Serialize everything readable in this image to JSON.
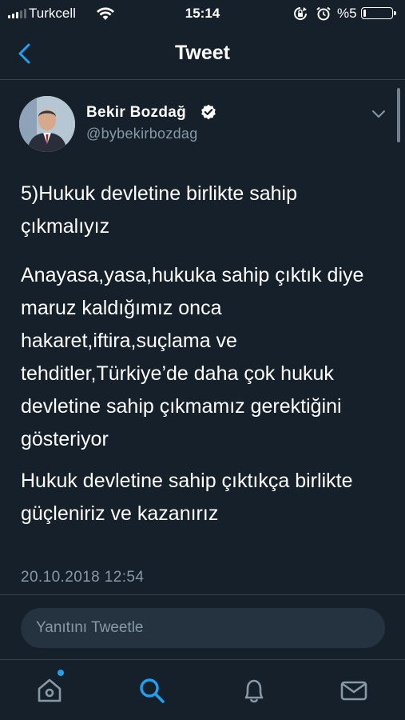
{
  "status_bar": {
    "carrier": "Turkcell",
    "time": "15:14",
    "battery_text": "%5",
    "battery_level_percent": 5
  },
  "nav": {
    "title": "Tweet"
  },
  "tweet": {
    "display_name": "Bekir  Bozdağ",
    "handle": "@bybekirbozdag",
    "paragraphs": [
      "5)Hukuk devletine birlikte sahip çıkmalıyız",
      "Anayasa,yasa,hukuka sahip çıktık diye maruz kaldığımız onca hakaret,iftira,suçlama ve tehditler,Türkiye’de daha çok hukuk devletine sahip çıkmamız gerektiğini gösteriyor",
      "Hukuk devletine sahip çıktıkça birlikte güçleniriz ve  kazanırız"
    ],
    "timestamp": "20.10.2018 12:54"
  },
  "reply": {
    "placeholder": "Yanıtını Tweetle"
  },
  "tab_bar": {
    "tabs": [
      "home-icon",
      "search-icon",
      "notifications-icon",
      "messages-icon"
    ],
    "active": "search-icon"
  },
  "colors": {
    "background": "#15202b",
    "accent": "#1da1f2",
    "secondary_text": "#8899a6",
    "divider": "#38444d"
  }
}
